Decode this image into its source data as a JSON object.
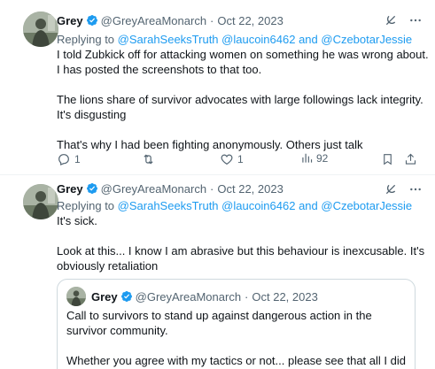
{
  "tweets": [
    {
      "name": "Grey",
      "handle": "@GreyAreaMonarch",
      "dot": "·",
      "date": "Oct 22, 2023",
      "reply_prefix": "Replying to ",
      "reply_mentions": "@SarahSeeksTruth @laucoin6462 and @CzebotarJessie",
      "body": [
        "I told Zubkick off for attacking women on something he was wrong about. I has posted the screenshots to that too.",
        "The lions share of survivor advocates with large followings lack integrity. It's disgusting",
        "That's why I had been fighting anonymously. Others just talk"
      ],
      "actions": {
        "replies": "1",
        "retweets": "",
        "likes": "1",
        "views": "92"
      }
    },
    {
      "name": "Grey",
      "handle": "@GreyAreaMonarch",
      "dot": "·",
      "date": "Oct 22, 2023",
      "reply_prefix": "Replying to ",
      "reply_mentions": "@SarahSeeksTruth @laucoin6462 and @CzebotarJessie",
      "body": [
        "It's sick.",
        "Look at this... I know I am abrasive but this behaviour is inexcusable. It's obviously retaliation"
      ],
      "quote": {
        "name": "Grey",
        "handle": "@GreyAreaMonarch",
        "dot": "·",
        "date": "Oct 22, 2023",
        "body": [
          "Call to survivors to stand up against dangerous action in the survivor community.",
          "Whether you agree with my tactics or not... please see that all I did was"
        ]
      }
    }
  ],
  "icons": {
    "verified": "verified-badge-icon",
    "grok": "grok-icon",
    "more": "more-icon",
    "reply": "reply-icon",
    "retweet": "retweet-icon",
    "like": "like-icon",
    "views": "views-icon",
    "bookmark": "bookmark-icon",
    "share": "share-icon"
  },
  "colors": {
    "accent": "#1d9bf0",
    "secondary_text": "#536471",
    "text": "#0f1419",
    "border": "#cfd9de"
  }
}
